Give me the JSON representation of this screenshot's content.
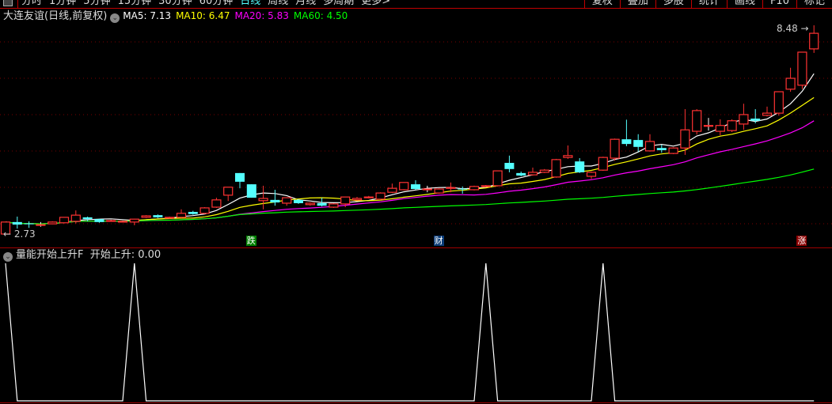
{
  "toolbar": {
    "periods": [
      "分时",
      "1分钟",
      "5分钟",
      "15分钟",
      "30分钟",
      "60分钟",
      "日线",
      "周线",
      "月线",
      "多周期",
      "更多>"
    ],
    "active_period": "日线",
    "right_buttons": [
      "复权",
      "叠加",
      "多股",
      "统计",
      "画线",
      "F10",
      "标记"
    ]
  },
  "header": {
    "stock_name": "大连友谊(日线,前复权)",
    "ma": [
      {
        "label": "MA5: 7.13",
        "color": "#ffffff"
      },
      {
        "label": "MA10: 6.47",
        "color": "#ffff00"
      },
      {
        "label": "MA20: 5.83",
        "color": "#ff00ff"
      },
      {
        "label": "MA60: 4.50",
        "color": "#00ff00"
      }
    ]
  },
  "price_labels": {
    "high": "8.48",
    "low": "2.73"
  },
  "signals": [
    {
      "text": "跌",
      "candle": 21,
      "bg": "#008000"
    },
    {
      "text": "财",
      "candle": 37,
      "bg": "#0a3c78"
    },
    {
      "text": "涨",
      "candle": 68,
      "bg": "#8b0000"
    }
  ],
  "indicator": {
    "name": "量能开始上升F",
    "value_label": "开始上升: 0.00"
  },
  "colors": {
    "up": "#ff3232",
    "down": "#54ffff",
    "grid": "#7a0000",
    "divider": "#a00000"
  },
  "chart_data": {
    "type": "candlestick",
    "ohlc_order": [
      "open",
      "high",
      "low",
      "close"
    ],
    "candles": [
      [
        2.73,
        3.06,
        2.73,
        3.06
      ],
      [
        3.06,
        3.21,
        2.88,
        2.99
      ],
      [
        3.02,
        3.08,
        2.9,
        3.0
      ],
      [
        2.99,
        3.06,
        2.93,
        2.99
      ],
      [
        3.01,
        3.08,
        3.0,
        3.06
      ],
      [
        3.04,
        3.19,
        3.02,
        3.19
      ],
      [
        3.08,
        3.38,
        3.02,
        3.25
      ],
      [
        3.19,
        3.21,
        3.08,
        3.14
      ],
      [
        3.14,
        3.15,
        3.04,
        3.06
      ],
      [
        3.1,
        3.12,
        3.08,
        3.1
      ],
      [
        3.08,
        3.1,
        3.05,
        3.08
      ],
      [
        3.06,
        3.15,
        2.97,
        3.14
      ],
      [
        3.19,
        3.25,
        3.17,
        3.23
      ],
      [
        3.25,
        3.27,
        3.17,
        3.19
      ],
      [
        3.17,
        3.21,
        3.15,
        3.19
      ],
      [
        3.19,
        3.41,
        3.17,
        3.3
      ],
      [
        3.34,
        3.37,
        3.26,
        3.28
      ],
      [
        3.3,
        3.47,
        3.28,
        3.45
      ],
      [
        3.47,
        3.73,
        3.45,
        3.67
      ],
      [
        3.8,
        4.02,
        3.64,
        4.02
      ],
      [
        4.41,
        4.41,
        3.99,
        4.17
      ],
      [
        4.1,
        4.1,
        3.73,
        3.73
      ],
      [
        3.65,
        4.06,
        3.41,
        3.71
      ],
      [
        3.67,
        3.95,
        3.51,
        3.6
      ],
      [
        3.58,
        3.73,
        3.51,
        3.73
      ],
      [
        3.67,
        3.69,
        3.56,
        3.58
      ],
      [
        3.54,
        3.6,
        3.51,
        3.58
      ],
      [
        3.58,
        3.73,
        3.49,
        3.51
      ],
      [
        3.47,
        3.58,
        3.45,
        3.56
      ],
      [
        3.56,
        3.75,
        3.47,
        3.75
      ],
      [
        3.67,
        3.75,
        3.65,
        3.71
      ],
      [
        3.73,
        3.78,
        3.71,
        3.75
      ],
      [
        3.69,
        3.88,
        3.67,
        3.86
      ],
      [
        3.88,
        4.12,
        3.86,
        3.99
      ],
      [
        3.95,
        4.15,
        3.93,
        4.15
      ],
      [
        4.1,
        4.21,
        3.95,
        3.97
      ],
      [
        3.97,
        4.06,
        3.88,
        3.97
      ],
      [
        3.86,
        3.99,
        3.84,
        3.97
      ],
      [
        3.99,
        4.15,
        3.88,
        4.01
      ],
      [
        3.98,
        4.04,
        3.84,
        3.97
      ],
      [
        3.95,
        4.06,
        3.93,
        4.04
      ],
      [
        4.04,
        4.08,
        4.02,
        4.06
      ],
      [
        4.06,
        4.47,
        4.04,
        4.47
      ],
      [
        4.69,
        4.89,
        4.43,
        4.52
      ],
      [
        4.41,
        4.45,
        4.32,
        4.34
      ],
      [
        4.36,
        4.56,
        4.34,
        4.43
      ],
      [
        4.43,
        4.52,
        4.41,
        4.49
      ],
      [
        4.3,
        4.8,
        4.28,
        4.78
      ],
      [
        4.84,
        5.17,
        4.8,
        4.89
      ],
      [
        4.73,
        4.82,
        4.41,
        4.43
      ],
      [
        4.32,
        4.45,
        4.25,
        4.43
      ],
      [
        4.49,
        4.86,
        4.47,
        4.84
      ],
      [
        4.82,
        5.36,
        4.75,
        5.34
      ],
      [
        5.34,
        5.88,
        5.15,
        5.21
      ],
      [
        5.32,
        5.48,
        4.99,
        5.13
      ],
      [
        5.02,
        5.48,
        5.0,
        5.28
      ],
      [
        5.1,
        5.19,
        4.97,
        5.04
      ],
      [
        4.95,
        5.12,
        4.93,
        5.1
      ],
      [
        5.1,
        6.17,
        4.91,
        5.6
      ],
      [
        5.56,
        6.17,
        5.47,
        6.13
      ],
      [
        5.72,
        5.93,
        5.58,
        5.72
      ],
      [
        5.56,
        5.89,
        5.45,
        5.72
      ],
      [
        5.58,
        5.89,
        5.54,
        5.85
      ],
      [
        5.76,
        6.32,
        5.6,
        6.02
      ],
      [
        5.91,
        6.17,
        5.78,
        5.85
      ],
      [
        6.0,
        6.24,
        5.97,
        6.06
      ],
      [
        6.06,
        6.65,
        5.99,
        6.65
      ],
      [
        6.72,
        7.31,
        6.65,
        7.02
      ],
      [
        6.83,
        7.74,
        6.72,
        7.74
      ],
      [
        7.83,
        8.48,
        7.72,
        8.26
      ]
    ],
    "ma_periods": [
      5,
      10,
      20,
      60
    ],
    "indicator_values": [
      1,
      0,
      0,
      0,
      0,
      0,
      0,
      0,
      0,
      0,
      0,
      1,
      0,
      0,
      0,
      0,
      0,
      0,
      0,
      0,
      0,
      0,
      0,
      0,
      0,
      0,
      0,
      0,
      0,
      0,
      0,
      0,
      0,
      0,
      0,
      0,
      0,
      0,
      0,
      0,
      0,
      1,
      0,
      0,
      0,
      0,
      0,
      0,
      0,
      0,
      0,
      1,
      0,
      0,
      0,
      0,
      0,
      0,
      0,
      0,
      0,
      0,
      0,
      0,
      0,
      0,
      0,
      0,
      0,
      0
    ],
    "ylim": [
      2.73,
      8.48
    ]
  }
}
